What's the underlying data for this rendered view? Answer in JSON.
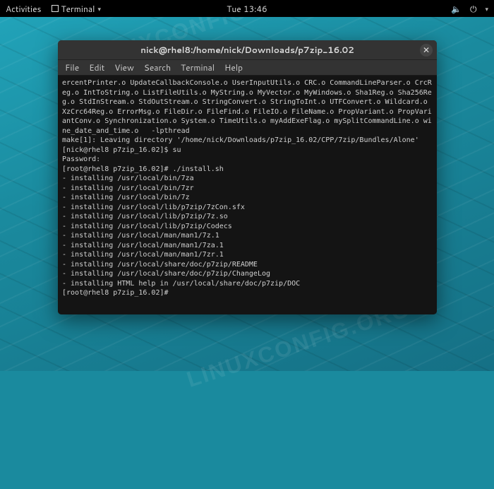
{
  "topbar": {
    "activities": "Activities",
    "app_label": "Terminal",
    "clock": "Tue 13:46"
  },
  "watermark": "LINUXCONFIG.ORG",
  "window": {
    "title": "nick@rhel8:/home/nick/Downloads/p7zip_16.02",
    "menu": {
      "file": "File",
      "edit": "Edit",
      "view": "View",
      "search": "Search",
      "terminal": "Terminal",
      "help": "Help"
    }
  },
  "terminal": {
    "lines": [
      "ercentPrinter.o UpdateCallbackConsole.o UserInputUtils.o CRC.o CommandLineParser.o CrcReg.o IntToString.o ListFileUtils.o MyString.o MyVector.o MyWindows.o Sha1Reg.o Sha256Reg.o StdInStream.o StdOutStream.o StringConvert.o StringToInt.o UTFConvert.o Wildcard.o XzCrc64Reg.o ErrorMsg.o FileDir.o FileFind.o FileIO.o FileName.o PropVariant.o PropVariantConv.o Synchronization.o System.o TimeUtils.o myAddExeFlag.o mySplitCommandLine.o wine_date_and_time.o   -lpthread",
      "make[1]: Leaving directory '/home/nick/Downloads/p7zip_16.02/CPP/7zip/Bundles/Alone'",
      "[nick@rhel8 p7zip_16.02]$ su",
      "Password:",
      "[root@rhel8 p7zip_16.02]# ./install.sh",
      "- installing /usr/local/bin/7za",
      "- installing /usr/local/bin/7zr",
      "- installing /usr/local/bin/7z",
      "- installing /usr/local/lib/p7zip/7zCon.sfx",
      "- installing /usr/local/lib/p7zip/7z.so",
      "- installing /usr/local/lib/p7zip/Codecs",
      "- installing /usr/local/man/man1/7z.1",
      "- installing /usr/local/man/man1/7za.1",
      "- installing /usr/local/man/man1/7zr.1",
      "- installing /usr/local/share/doc/p7zip/README",
      "- installing /usr/local/share/doc/p7zip/ChangeLog",
      "- installing HTML help in /usr/local/share/doc/p7zip/DOC",
      "[root@rhel8 p7zip_16.02]# "
    ]
  }
}
